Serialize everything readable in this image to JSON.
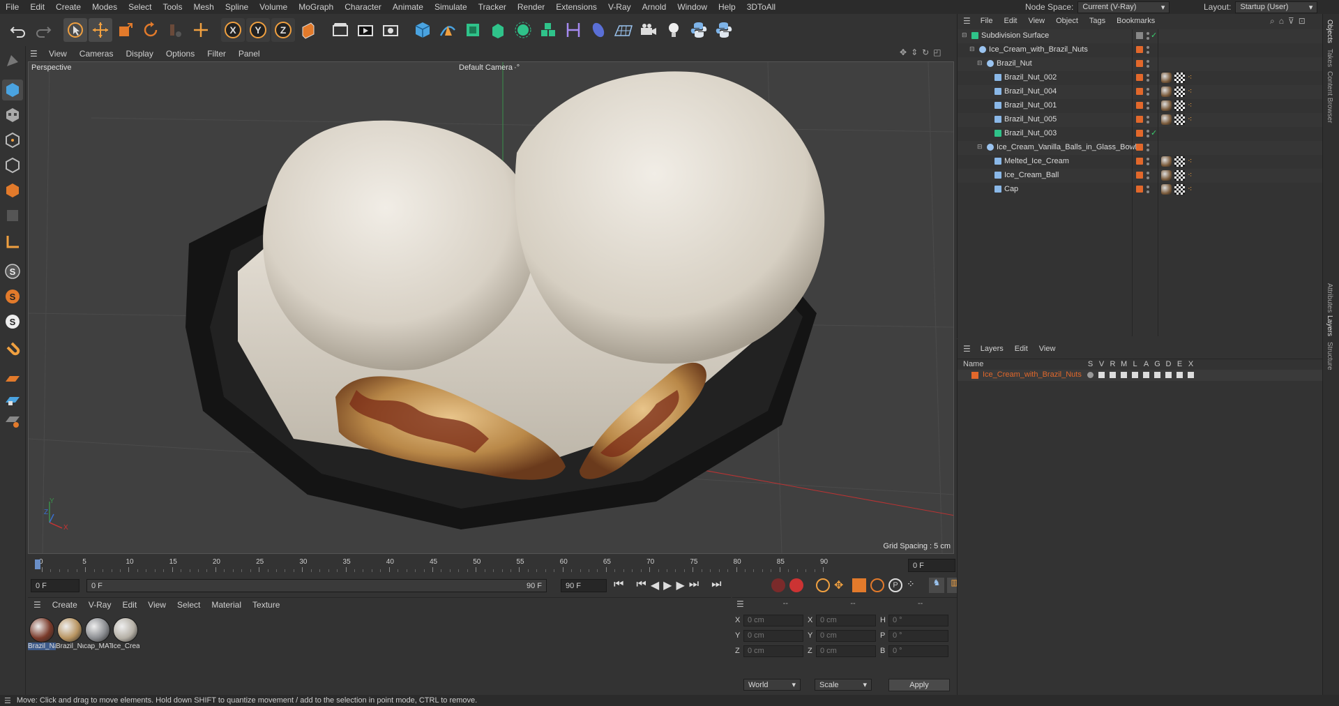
{
  "menubar": {
    "items": [
      "File",
      "Edit",
      "Create",
      "Modes",
      "Select",
      "Tools",
      "Mesh",
      "Spline",
      "Volume",
      "MoGraph",
      "Character",
      "Animate",
      "Simulate",
      "Tracker",
      "Render",
      "Extensions",
      "V-Ray",
      "Arnold",
      "Window",
      "Help",
      "3DToAll"
    ],
    "node_space_label": "Node Space:",
    "node_space_value": "Current (V-Ray)",
    "layout_label": "Layout:",
    "layout_value": "Startup (User)"
  },
  "viewport": {
    "menu": [
      "View",
      "Cameras",
      "Display",
      "Options",
      "Filter",
      "Panel"
    ],
    "view_name": "Perspective",
    "camera_label": "Default Camera",
    "grid_spacing": "Grid Spacing : 5 cm",
    "axis_x": "X",
    "axis_y": "Y",
    "axis_z": "Z"
  },
  "timeline": {
    "ticks": [
      "0",
      "5",
      "10",
      "15",
      "20",
      "25",
      "30",
      "35",
      "40",
      "45",
      "50",
      "55",
      "60",
      "65",
      "70",
      "75",
      "80",
      "85",
      "90"
    ],
    "current_frame": "0 F",
    "start_frame": "0 F",
    "range_start": "0 F",
    "range_end": "90 F",
    "end_frame": "90 F"
  },
  "material_panel": {
    "menu": [
      "Create",
      "V-Ray",
      "Edit",
      "View",
      "Select",
      "Material",
      "Texture"
    ],
    "materials": [
      {
        "name": "Brazil_Na",
        "color": "#7a3a2a"
      },
      {
        "name": "Brazil_Nu",
        "color": "#b89460"
      },
      {
        "name": "cap_MAT",
        "color": "#8a8c90"
      },
      {
        "name": "Ice_Crea",
        "color": "#b5b0a6"
      }
    ]
  },
  "coord_panel": {
    "headers": [
      "--",
      "--",
      "--"
    ],
    "rows": [
      {
        "a_label": "X",
        "a_val": "0 cm",
        "b_label": "X",
        "b_val": "0 cm",
        "c_label": "H",
        "c_val": "0 °"
      },
      {
        "a_label": "Y",
        "a_val": "0 cm",
        "b_label": "Y",
        "b_val": "0 cm",
        "c_label": "P",
        "c_val": "0 °"
      },
      {
        "a_label": "Z",
        "a_val": "0 cm",
        "b_label": "Z",
        "b_val": "0 cm",
        "c_label": "B",
        "c_val": "0 °"
      }
    ],
    "coord_system": "World",
    "mode": "Scale",
    "apply_label": "Apply"
  },
  "object_manager": {
    "menu": [
      "File",
      "Edit",
      "View",
      "Object",
      "Tags",
      "Bookmarks"
    ],
    "objects": [
      {
        "name": "Subdivision Surface",
        "depth": 0,
        "kind": "subdiv"
      },
      {
        "name": "Ice_Cream_with_Brazil_Nuts",
        "depth": 1,
        "kind": "null"
      },
      {
        "name": "Brazil_Nut",
        "depth": 2,
        "kind": "null"
      },
      {
        "name": "Brazil_Nut_002",
        "depth": 3,
        "kind": "poly"
      },
      {
        "name": "Brazil_Nut_004",
        "depth": 3,
        "kind": "poly"
      },
      {
        "name": "Brazil_Nut_001",
        "depth": 3,
        "kind": "poly"
      },
      {
        "name": "Brazil_Nut_005",
        "depth": 3,
        "kind": "poly"
      },
      {
        "name": "Brazil_Nut_003",
        "depth": 3,
        "kind": "spline"
      },
      {
        "name": "Ice_Cream_Vanilla_Balls_in_Glass_Bowl",
        "depth": 2,
        "kind": "null"
      },
      {
        "name": "Melted_Ice_Cream",
        "depth": 3,
        "kind": "poly"
      },
      {
        "name": "Ice_Cream_Ball",
        "depth": 3,
        "kind": "poly"
      },
      {
        "name": "Cap",
        "depth": 3,
        "kind": "poly"
      }
    ]
  },
  "layer_manager": {
    "menu": [
      "Layers",
      "Edit",
      "View"
    ],
    "column_name": "Name",
    "columns": [
      "S",
      "V",
      "R",
      "M",
      "L",
      "A",
      "G",
      "D",
      "E",
      "X"
    ],
    "layers": [
      {
        "name": "Ice_Cream_with_Brazil_Nuts",
        "color": "#e2682b"
      }
    ]
  },
  "side_tabs": [
    "Objects",
    "Takes",
    "Content Browser",
    "Attributes",
    "Layers",
    "Structure"
  ],
  "status_bar": {
    "text": "Move: Click and drag to move elements. Hold down SHIFT to quantize movement / add to the selection in point mode, CTRL to remove."
  }
}
